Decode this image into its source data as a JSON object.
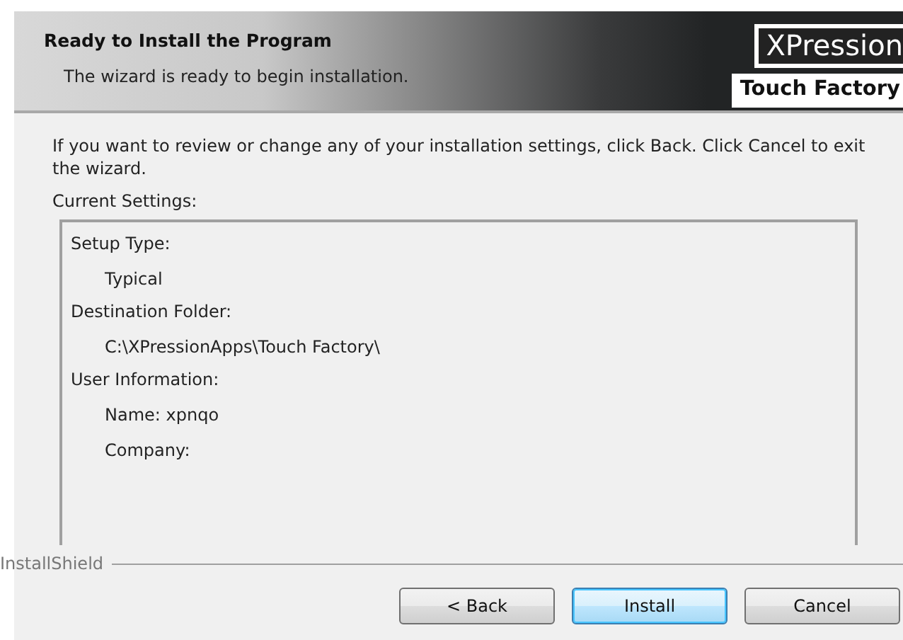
{
  "header": {
    "title": "Ready to Install the Program",
    "subtitle": "The wizard is ready to begin installation.",
    "logo": {
      "line_1": "XPression",
      "line_2": "Touch Factory"
    }
  },
  "instructions": "If you want to review or change any of your installation settings, click Back. Click Cancel to exit the wizard.",
  "settings": {
    "label": "Current Settings:",
    "sections": [
      {
        "heading": "Setup Type:",
        "children": [
          "Typical"
        ]
      },
      {
        "heading": "Destination Folder:",
        "children": [
          "C:\\XPressionApps\\Touch Factory\\"
        ]
      },
      {
        "heading": "User Information:",
        "children": [
          "Name: xpnqo",
          "Company:"
        ]
      }
    ]
  },
  "footer": {
    "brand": "InstallShield"
  },
  "buttons": [
    {
      "label": "< Back",
      "default": false
    },
    {
      "label": "Install",
      "default": true
    },
    {
      "label": "Cancel",
      "default": false
    }
  ]
}
